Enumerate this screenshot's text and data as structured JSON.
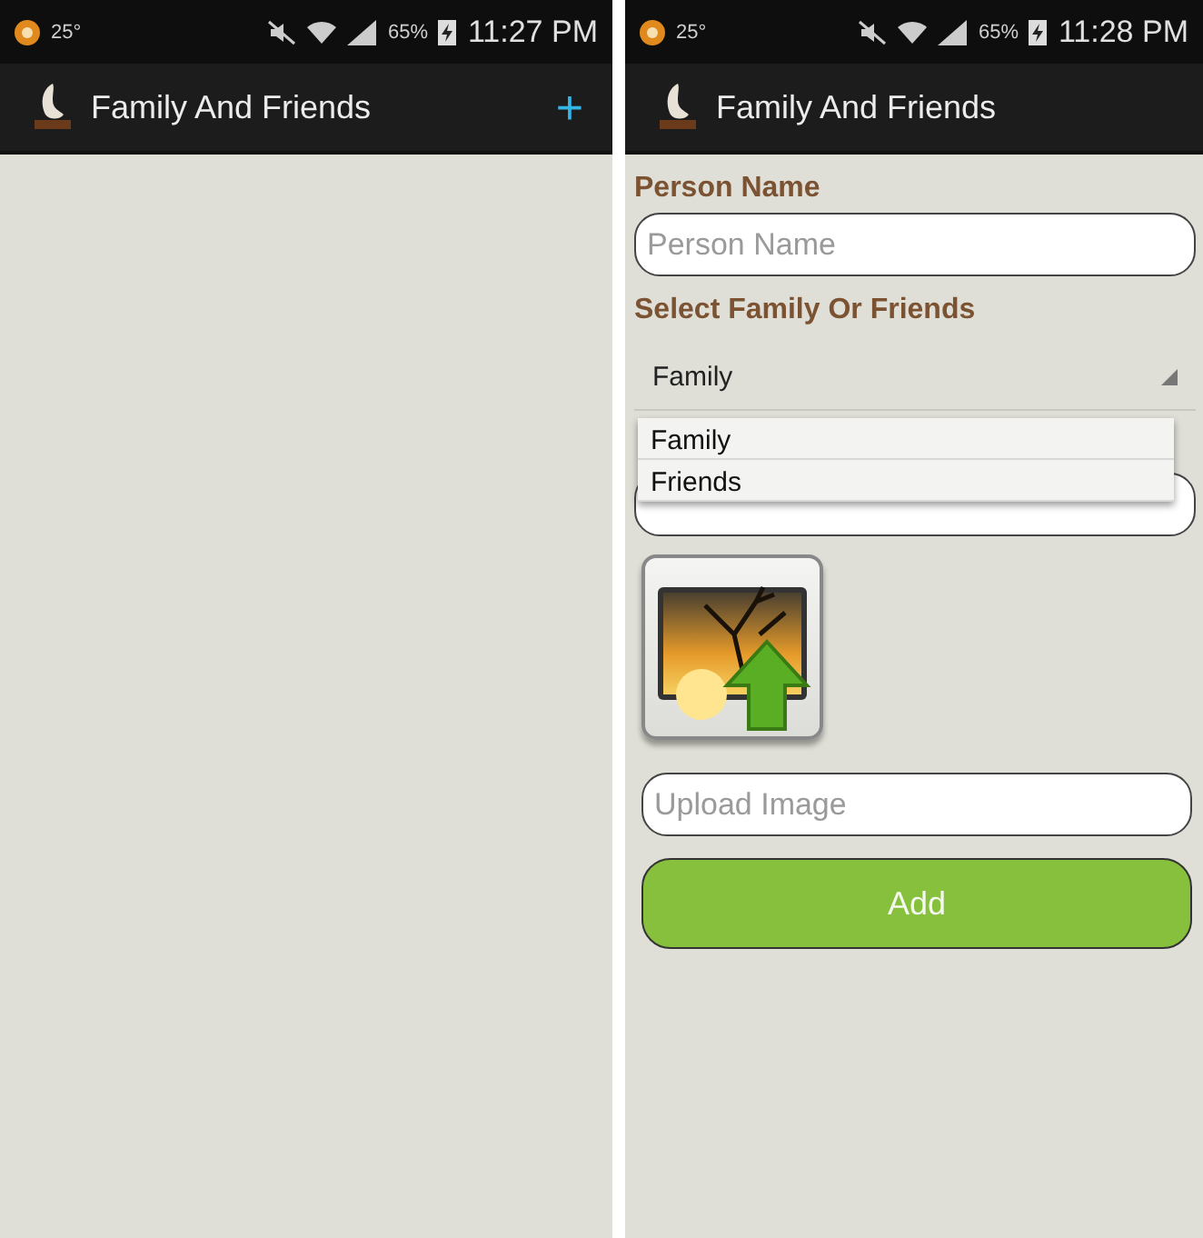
{
  "screens": [
    {
      "kind": "list",
      "status_bar": {
        "temperature": "25°",
        "battery": "65%",
        "time": "11:27 PM"
      },
      "app_bar": {
        "title": "Family And Friends",
        "action": "+"
      }
    },
    {
      "kind": "form",
      "status_bar": {
        "temperature": "25°",
        "battery": "65%",
        "time": "11:28 PM"
      },
      "app_bar": {
        "title": "Family And Friends"
      },
      "form": {
        "person_name": {
          "label": "Person Name",
          "placeholder": "Person Name"
        },
        "category": {
          "label": "Select Family Or Friends",
          "value": "Family",
          "options": [
            "Family",
            "Friends"
          ]
        },
        "upload": {
          "placeholder": "Upload Image"
        },
        "submit": "Add"
      }
    }
  ]
}
